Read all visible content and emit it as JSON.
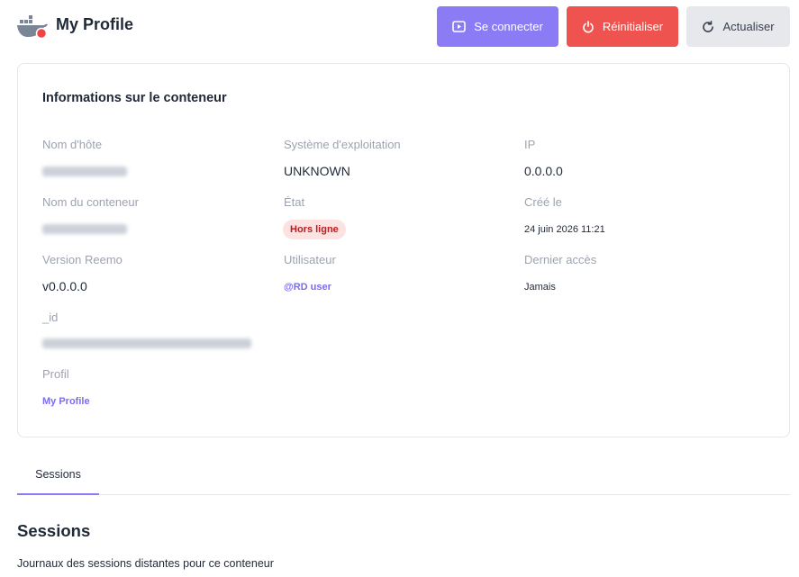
{
  "header": {
    "title": "My Profile",
    "logo_icon": "docker-whale-icon",
    "status_dot_color": "#ef4444",
    "buttons": {
      "connect": {
        "label": "Se connecter",
        "icon": "play-screen-icon",
        "color": "#8b7cf6"
      },
      "reset": {
        "label": "Réinitialiser",
        "icon": "power-reset-icon",
        "color": "#ef5350"
      },
      "refresh": {
        "label": "Actualiser",
        "icon": "refresh-icon",
        "color": "#e7e8ec"
      }
    }
  },
  "container_info": {
    "title": "Informations sur le conteneur",
    "hostname": {
      "label": "Nom d'hôte"
    },
    "os": {
      "label": "Système d'exploitation",
      "value": "UNKNOWN"
    },
    "ip": {
      "label": "IP",
      "value": "0.0.0.0"
    },
    "container_name": {
      "label": "Nom du conteneur"
    },
    "state": {
      "label": "État",
      "value": "Hors ligne"
    },
    "created": {
      "label": "Créé le",
      "value": "24 juin 2026 11:21"
    },
    "reemo_version": {
      "label": "Version Reemo",
      "value": "v0.0.0.0"
    },
    "user": {
      "label": "Utilisateur",
      "value": "@RD user"
    },
    "last_access": {
      "label": "Dernier accès",
      "value": "Jamais"
    },
    "id": {
      "label": "_id"
    },
    "profile": {
      "label": "Profil",
      "value": "My Profile"
    }
  },
  "tabs": [
    {
      "label": "Sessions",
      "active": true
    }
  ],
  "sessions": {
    "title": "Sessions",
    "description": "Journaux des sessions distantes pour ce conteneur"
  }
}
